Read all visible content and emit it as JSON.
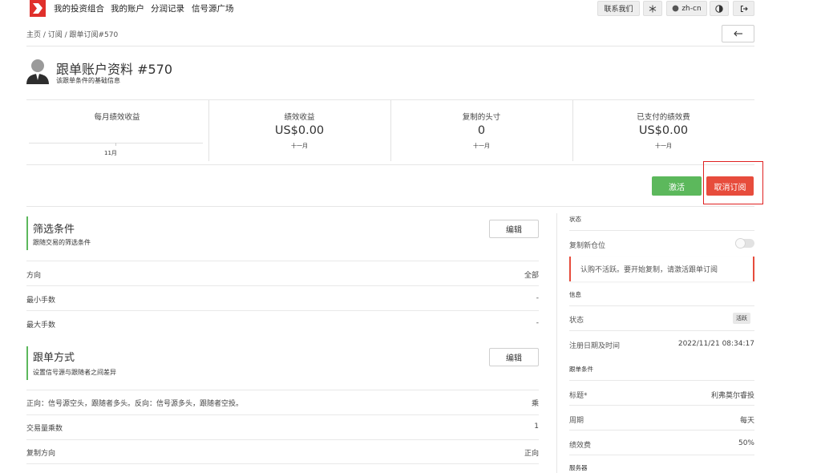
{
  "nav": {
    "items": [
      "我的投资组合",
      "我的账户",
      "分润记录",
      "信号源广场"
    ],
    "contact_label": "联系我们",
    "language_label": "zh-cn"
  },
  "breadcrumb": "主页 / 订阅 / 跟单订阅#570",
  "profile": {
    "title": "跟单账户资料 #570",
    "subtitle": "该跟单条件的基础信息"
  },
  "stats": {
    "monthly_label": "每月绩效收益",
    "monthly_axis_label": "11月",
    "items": [
      {
        "label": "绩效收益",
        "value": "US$0.00",
        "period": "十一月"
      },
      {
        "label": "复制的头寸",
        "value": "0",
        "period": "十一月"
      },
      {
        "label": "已支付的绩效费",
        "value": "US$0.00",
        "period": "十一月"
      }
    ]
  },
  "actions": {
    "activate_label": "激活",
    "unsubscribe_label": "取消订阅"
  },
  "filter_section": {
    "title": "筛选条件",
    "desc": "跟随交易的筛选条件",
    "edit_label": "编辑",
    "rows": [
      {
        "label": "方向",
        "value": "全部"
      },
      {
        "label": "最小手数",
        "value": "-"
      },
      {
        "label": "最大手数",
        "value": "-"
      }
    ]
  },
  "copy_section": {
    "title": "跟单方式",
    "desc": "设置信号源与跟随者之间差异",
    "edit_label": "编辑",
    "rows": [
      {
        "label": "正向：信号源空头，跟随者多头。反向：信号源多头，跟随者空投。",
        "value": "乘"
      },
      {
        "label": "交易量乘数",
        "value": "1"
      },
      {
        "label": "复制方向",
        "value": "正向"
      }
    ]
  },
  "right_panel": {
    "status_head": "状态",
    "copy_new_label": "复制新仓位",
    "alert_text": "认购不活跃。要开始复制，请激活跟单订阅",
    "info_head": "信息",
    "status_label": "状态",
    "status_badge": "活跃",
    "reg_label": "注册日期及时间",
    "reg_value": "2022/11/21 08:34:17",
    "terms_head": "跟单条件",
    "title_label": "标题*",
    "title_value": "利弗莫尔睿投",
    "period_label": "周期",
    "period_value": "每天",
    "fee_label": "绩效费",
    "fee_value": "50%",
    "server_head": "服务器"
  },
  "colors": {
    "brand": "#e0302b",
    "activate": "#5cb85c",
    "unsubscribe": "#e74c3c"
  }
}
